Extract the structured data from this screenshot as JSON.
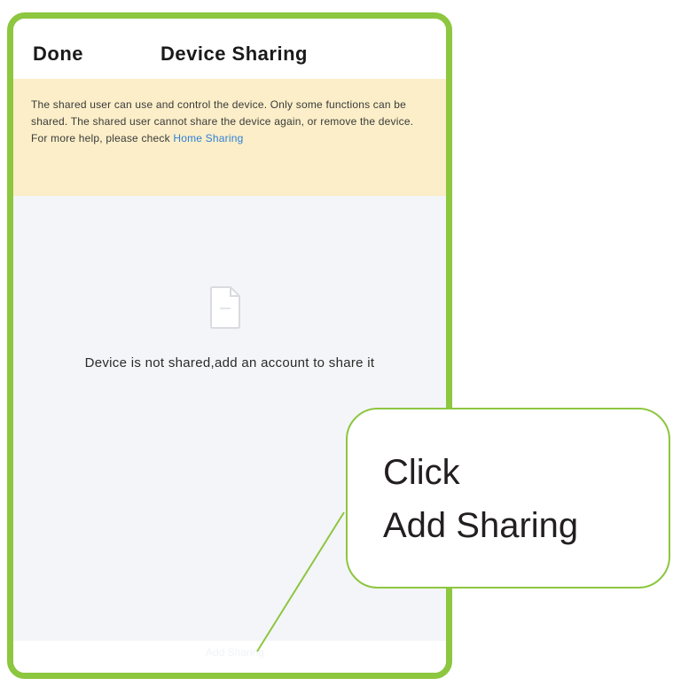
{
  "nav": {
    "done_label": "Done",
    "title": "Device Sharing"
  },
  "notice": {
    "text": "The shared user can use and control the device. Only some functions can be shared. The shared user cannot share the device again, or remove the device. For more help, please check ",
    "link_label": "Home Sharing"
  },
  "empty_state": {
    "icon": "document-icon",
    "message": "Device is not shared,add an account to share it"
  },
  "bottom": {
    "add_sharing_label": "Add Sharing"
  },
  "callout": {
    "line1": "Click",
    "line2": "Add Sharing"
  },
  "colors": {
    "frame": "#8dc63f",
    "notice_bg": "#fbeec8",
    "link": "#2f7fd8",
    "page_bg": "#f4f5f8"
  }
}
